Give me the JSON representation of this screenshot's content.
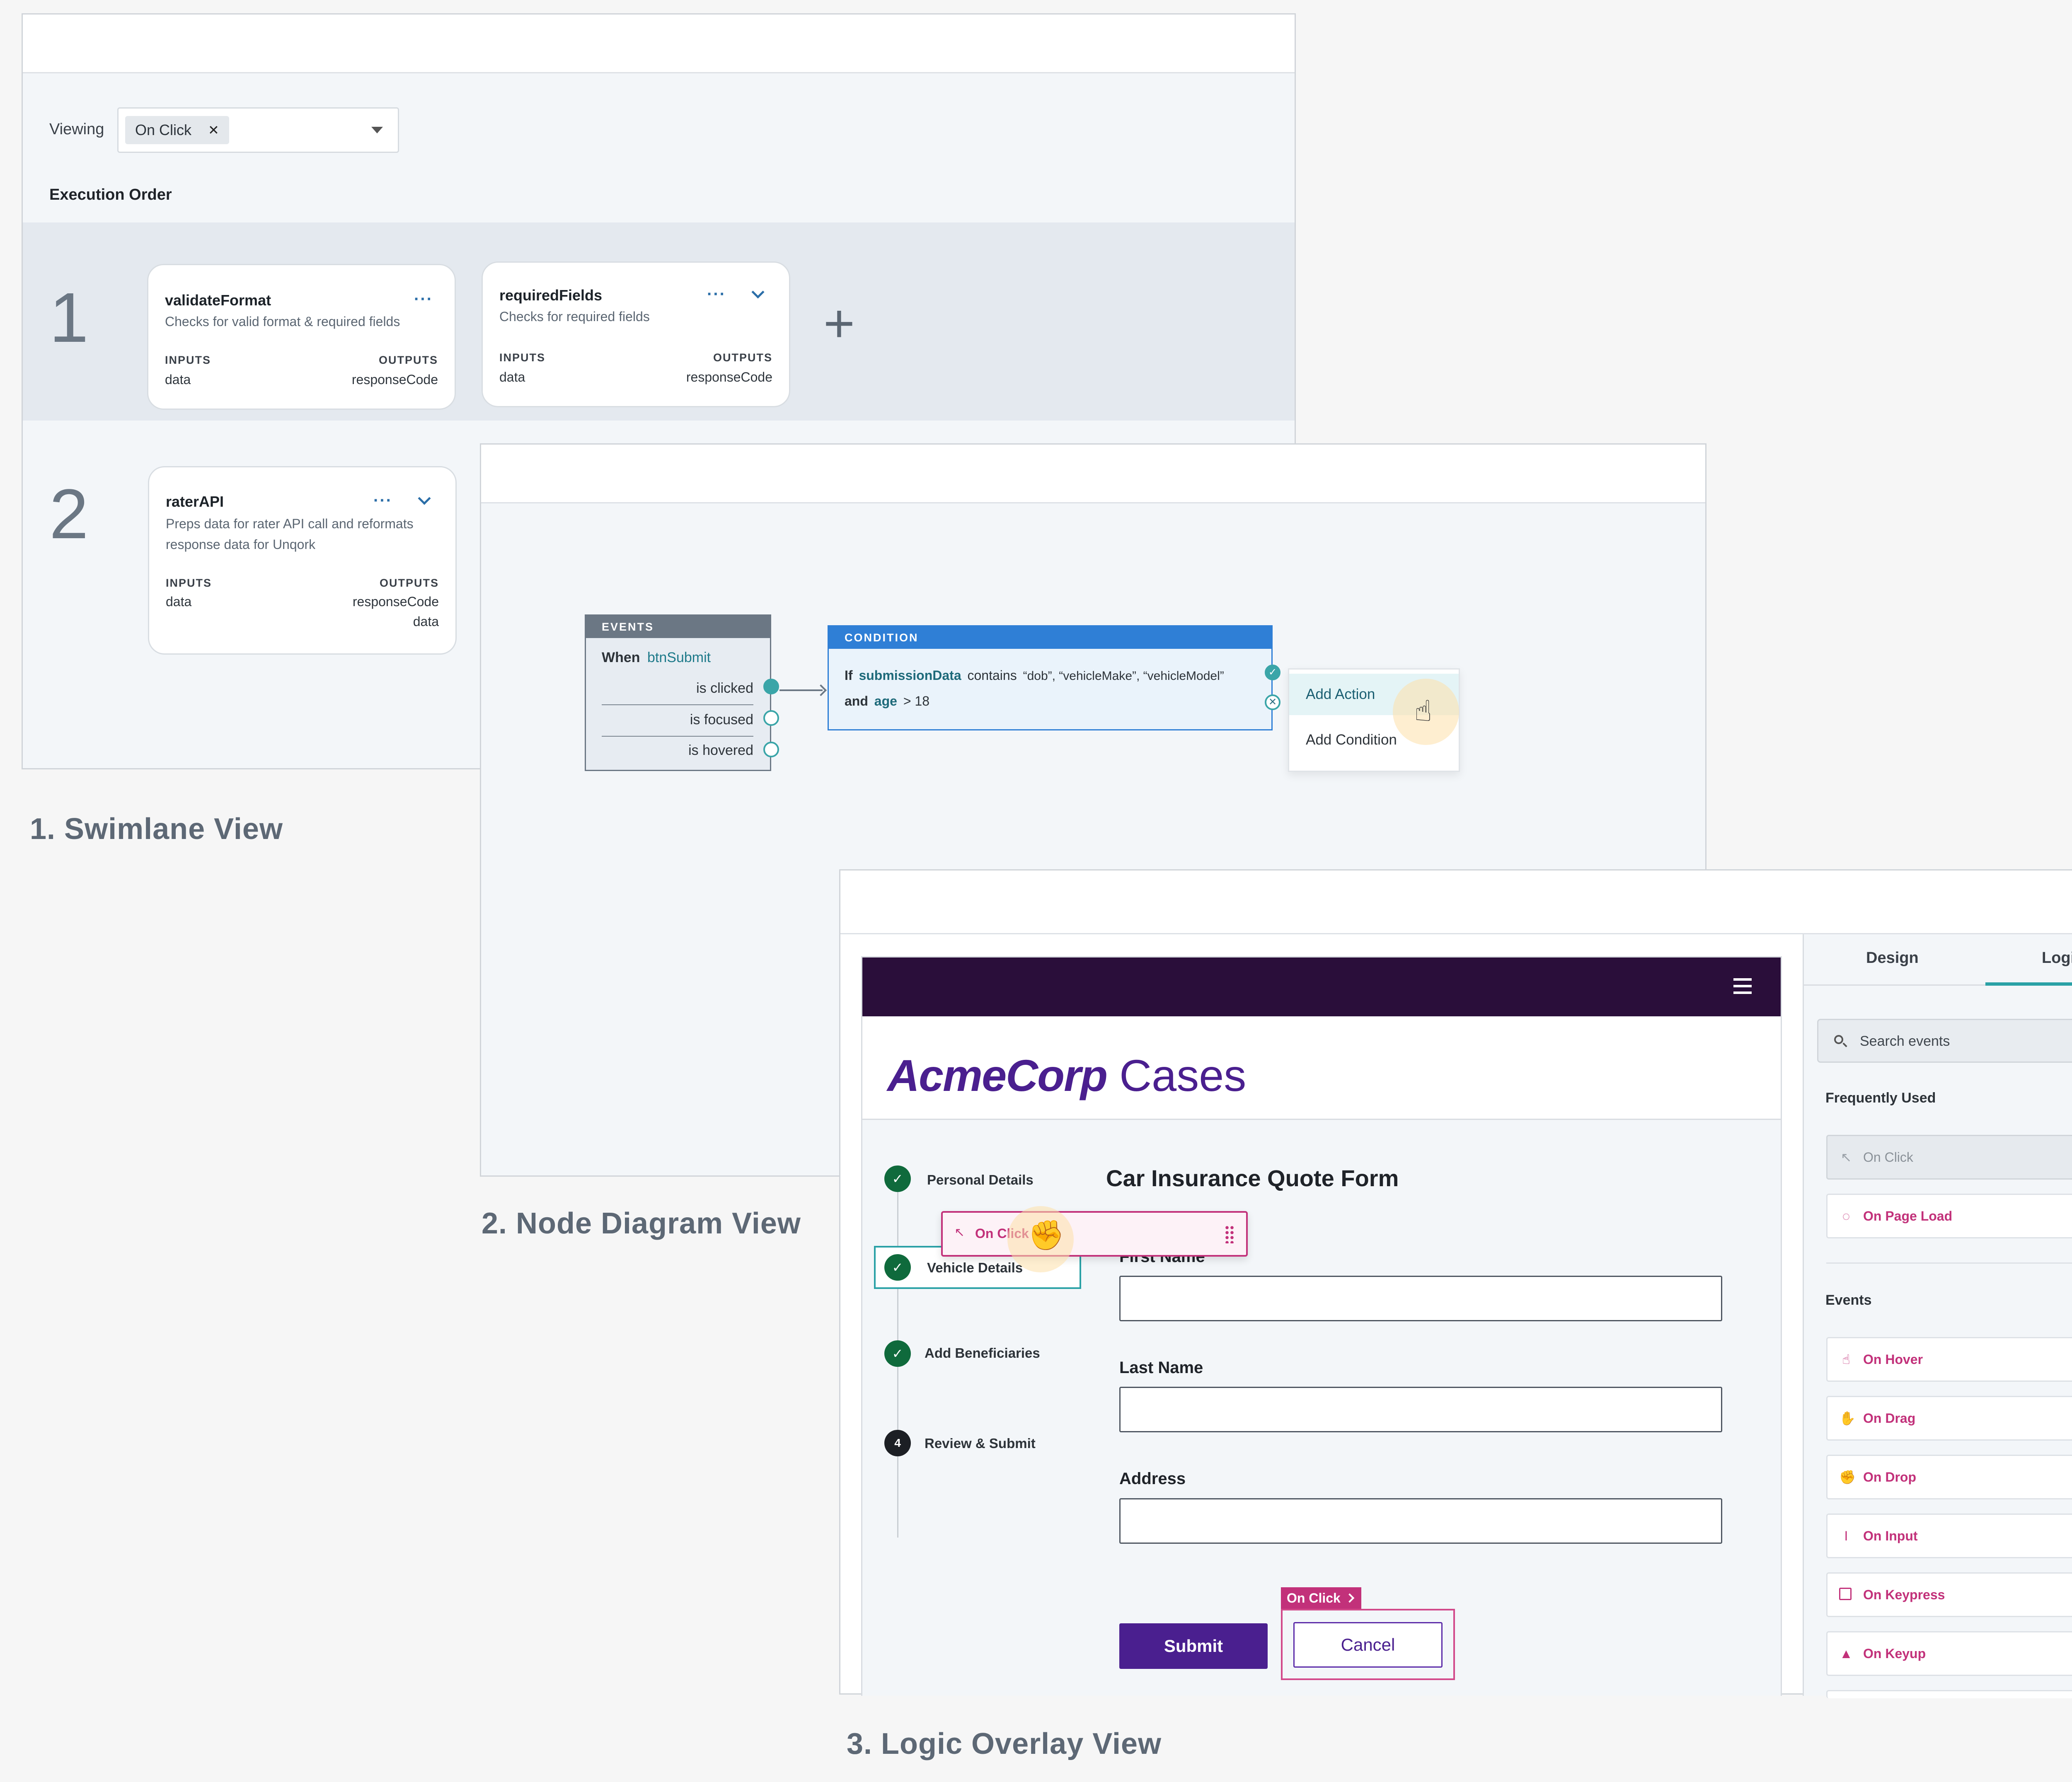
{
  "swimlane": {
    "viewing_label": "Viewing",
    "viewing_chip": "On Click",
    "chip_remove": "✕",
    "execution_label": "Execution Order",
    "lanes": [
      {
        "number": "1",
        "cards": [
          {
            "title": "validateFormat",
            "desc": [
              "Checks for valid format & required fields"
            ],
            "inputs_label": "INPUTS",
            "outputs_label": "OUTPUTS",
            "inputs": [
              "data"
            ],
            "outputs": [
              "responseCode"
            ]
          },
          {
            "title": "requiredFields",
            "desc": [
              "Checks for required fields"
            ],
            "inputs_label": "INPUTS",
            "outputs_label": "OUTPUTS",
            "inputs": [
              "data"
            ],
            "outputs": [
              "responseCode"
            ]
          }
        ],
        "add": "+"
      },
      {
        "number": "2",
        "cards": [
          {
            "title": "raterAPI",
            "desc": [
              "Preps data for rater API call and reformats",
              "response data for Unqork"
            ],
            "inputs_label": "INPUTS",
            "outputs_label": "OUTPUTS",
            "inputs": [
              "data"
            ],
            "outputs": [
              "responseCode",
              "data"
            ]
          }
        ]
      }
    ],
    "caption": "1. Swimlane View"
  },
  "node_diagram": {
    "events": {
      "header": "EVENTS",
      "when": "When",
      "target": "btnSubmit",
      "rows": [
        "is clicked",
        "is focused",
        "is hovered"
      ]
    },
    "condition": {
      "header": "CONDITION",
      "if": "If",
      "var": "submissionData",
      "op": "contains",
      "values": "“dob”,  “vehicleMake”, “vehicleModel”",
      "and": "and",
      "var2": "age",
      "cmp": "> 18"
    },
    "menu": [
      "Add Action",
      "Add Condition"
    ],
    "caption": "2. Node Diagram View"
  },
  "logic_overlay": {
    "brand_bold": "AcmeCorp",
    "brand_light": " Cases",
    "steps": [
      {
        "label": "Personal Details",
        "mark": "✓"
      },
      {
        "label": "Vehicle Details",
        "mark": "✓"
      },
      {
        "label": "Add Beneficiaries",
        "mark": "✓"
      },
      {
        "label": "Review & Submit",
        "mark": "4"
      }
    ],
    "form_title": "Car Insurance Quote Form",
    "fields": [
      "First Name",
      "Last Name",
      "Address"
    ],
    "submit": "Submit",
    "cancel": "Cancel",
    "drag_chip": "On Click",
    "cancel_tag": "On Click",
    "tabs": [
      "Design",
      "Logic"
    ],
    "search_placeholder": "Search events",
    "frequently_used": {
      "title": "Frequently Used",
      "items": [
        {
          "label": "On Click",
          "icon": "pointer-icon"
        },
        {
          "label": "On Page Load",
          "icon": "spinner-icon"
        }
      ]
    },
    "events": {
      "title": "Events",
      "items": [
        {
          "label": "On Hover",
          "icon": "hover-hand-icon"
        },
        {
          "label": "On Drag",
          "icon": "drag-hand-icon"
        },
        {
          "label": "On Drop",
          "icon": "drop-hand-icon"
        },
        {
          "label": "On Input",
          "icon": "text-cursor-icon"
        },
        {
          "label": "On Keypress",
          "icon": "key-icon"
        },
        {
          "label": "On Keyup",
          "icon": "triangle-up-icon"
        }
      ]
    },
    "caption": "3.  Logic Overlay View"
  }
}
